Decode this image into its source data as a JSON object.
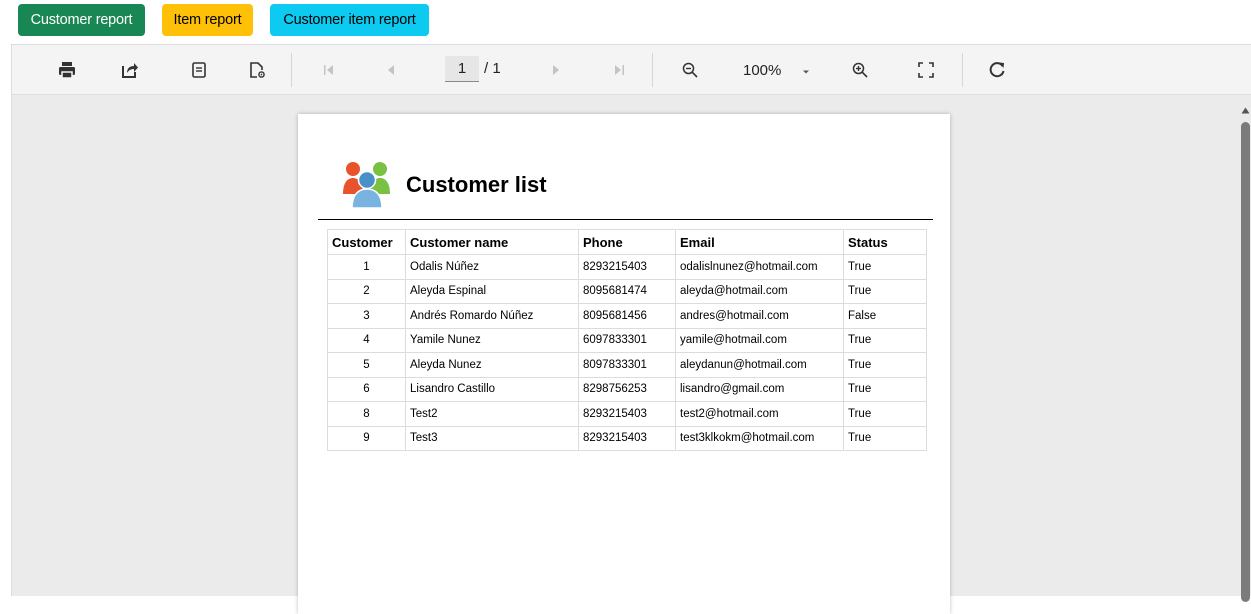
{
  "report_buttons": {
    "customer": "Customer report",
    "item": "Item report",
    "customer_item": "Customer item report"
  },
  "toolbar": {
    "icons": [
      "print-icon",
      "export-icon",
      "document-icon",
      "page-setup-icon",
      "first-page-icon",
      "previous-page-icon",
      "next-page-icon",
      "last-page-icon",
      "zoom-out-icon",
      "zoom-in-icon",
      "fullscreen-icon",
      "refresh-icon"
    ],
    "current_page": "1",
    "total_pages": "/ 1",
    "zoom": "100%"
  },
  "report": {
    "title": "Customer list",
    "logo": "customers-group-icon",
    "columns": [
      "Customer",
      "Customer name",
      "Phone",
      "Email",
      "Status"
    ],
    "rows": [
      {
        "id": "1",
        "name": "Odalis Núñez",
        "phone": "8293215403",
        "email": "odalislnunez@hotmail.com",
        "status": "True"
      },
      {
        "id": "2",
        "name": "Aleyda Espinal",
        "phone": "8095681474",
        "email": "aleyda@hotmail.com",
        "status": "True"
      },
      {
        "id": "3",
        "name": "Andrés Romardo Núñez",
        "phone": "8095681456",
        "email": "andres@hotmail.com",
        "status": "False"
      },
      {
        "id": "4",
        "name": "Yamile Nunez",
        "phone": "6097833301",
        "email": "yamile@hotmail.com",
        "status": "True"
      },
      {
        "id": "5",
        "name": "Aleyda Nunez",
        "phone": "8097833301",
        "email": "aleydanun@hotmail.com",
        "status": "True"
      },
      {
        "id": "6",
        "name": "Lisandro Castillo",
        "phone": "8298756253",
        "email": "lisandro@gmail.com",
        "status": "True"
      },
      {
        "id": "8",
        "name": "Test2",
        "phone": "8293215403",
        "email": "test2@hotmail.com",
        "status": "True"
      },
      {
        "id": "9",
        "name": "Test3",
        "phone": "8293215403",
        "email": "test3klkokm@hotmail.com",
        "status": "True"
      }
    ]
  },
  "colors": {
    "customer_button": "#198754",
    "item_button": "#ffc107",
    "customer_item_button": "#0dcaf0"
  }
}
